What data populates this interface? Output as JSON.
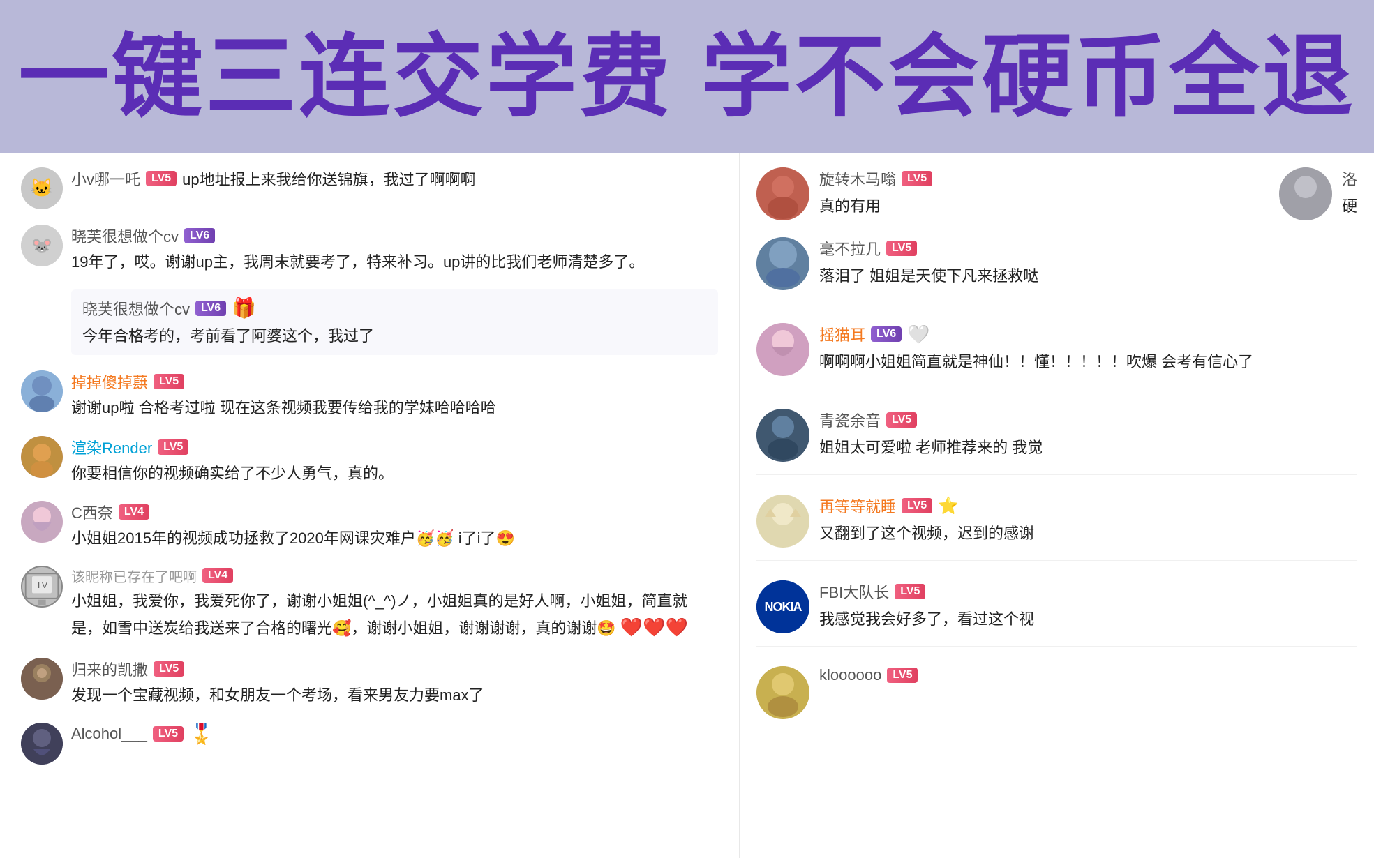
{
  "header": {
    "title": "一键三连交学费 学不会硬币全退"
  },
  "left_comments": [
    {
      "id": "c1",
      "username": "小v哪一吒",
      "username_color": "normal",
      "level": "LV5",
      "level_style": "lv5",
      "avatar_emoji": "🐱",
      "avatar_style": "light-gray",
      "text": "up地址报上来我给你送锦旗，我过了啊啊啊"
    },
    {
      "id": "c2",
      "username": "晓芙很想做个cv",
      "username_color": "normal",
      "level": "LV6",
      "level_style": "lv6",
      "avatar_emoji": "🐭",
      "avatar_style": "light-gray",
      "text": "19年了，哎。谢谢up主，我周末就要考了，特来补习。up讲的比我们老师清楚多了。"
    },
    {
      "id": "c3_nested",
      "username": "晓芙很想做个cv",
      "username_color": "normal",
      "level": "LV6",
      "level_style": "lv6",
      "has_gift": true,
      "text": "今年合格考的，考前看了阿婆这个，我过了"
    },
    {
      "id": "c4",
      "username": "掉掉傻掉蕻",
      "username_color": "orange",
      "level": "LV5",
      "level_style": "lv5",
      "avatar_emoji": "🐶",
      "avatar_style": "blue-anime",
      "text": "谢谢up啦 合格考过啦 现在这条视频我要传给我的学妹哈哈哈哈"
    },
    {
      "id": "c5",
      "username": "渲染Render",
      "username_color": "blue",
      "level": "LV5",
      "level_style": "lv5",
      "avatar_emoji": "🦊",
      "avatar_style": "fox",
      "text": "你要相信你的视频确实给了不少人勇气，真的。"
    },
    {
      "id": "c6",
      "username": "C西奈",
      "username_color": "normal",
      "level": "LV4",
      "level_style": "lv5",
      "avatar_emoji": "🌸",
      "avatar_style": "anime-girl",
      "text": "小姐姐2015年的视频成功拯救了2020年网课灾难户🥳🥳 i了i了😍"
    },
    {
      "id": "c7_deleted",
      "username": "该昵称已存在了吧啊",
      "username_color": "deleted",
      "level": "LV4",
      "level_style": "lv5",
      "avatar_emoji": "📺",
      "avatar_style": "tv",
      "text": "小姐姐，我爱你，我爱死你了，谢谢小姐姐(^_^)ノ，小姐姐真的是好人啊，小姐姐，简直就是，如雪中送炭给我送来了合格的曙光🥰，谢谢小姐姐，谢谢谢谢，真的谢谢🤩 ❤️❤️❤️"
    },
    {
      "id": "c8",
      "username": "归来的凯撒",
      "username_color": "normal",
      "level": "LV5",
      "level_style": "lv5",
      "avatar_emoji": "🦝",
      "avatar_style": "raccoon",
      "text": "发现一个宝藏视频，和女朋友一个考场，看来男友力要max了"
    },
    {
      "id": "c9",
      "username": "Alcohol___",
      "username_color": "normal",
      "level": "LV5",
      "level_style": "lv5",
      "avatar_emoji": "🌙",
      "avatar_style": "anime-dark",
      "has_gift2": true
    }
  ],
  "right_comments": [
    {
      "id": "r1",
      "username": "旋转木马嗡",
      "username_color": "normal",
      "level": "LV5",
      "level_style": "lv5",
      "avatar_emoji": "🙏",
      "avatar_style": "warm",
      "text": "真的有用"
    },
    {
      "id": "r2_extra",
      "username": "洛",
      "username_color": "normal",
      "level": "",
      "text": "硬",
      "avatar_emoji": "🐱",
      "avatar_style": "gray2"
    },
    {
      "id": "r3",
      "username": "毫不拉几",
      "username_color": "normal",
      "level": "LV5",
      "level_style": "lv5",
      "avatar_emoji": "🌅",
      "avatar_style": "sunset",
      "text": "落泪了 姐姐是天使下凡来拯救哒"
    },
    {
      "id": "r4",
      "username": "摇猫耳",
      "username_color": "orange",
      "level": "LV6",
      "level_style": "lv6",
      "avatar_emoji": "🐱",
      "avatar_style": "pink-anime",
      "has_heart": true,
      "text": "啊啊啊小姐姐简直就是神仙！！懂！！！！！吹爆 会考有信心了"
    },
    {
      "id": "r5",
      "username": "青瓷余音",
      "username_color": "normal",
      "level": "LV5",
      "level_style": "lv5",
      "avatar_emoji": "🌊",
      "avatar_style": "blue-dark",
      "text": "姐姐太可爱啦 老师推荐来的 我觉"
    },
    {
      "id": "r6",
      "username": "再等等就睡",
      "username_color": "orange",
      "level": "LV5",
      "level_style": "lv5",
      "avatar_emoji": "🐈",
      "avatar_style": "cat-anime",
      "has_star": true,
      "text": "又翻到了这个视频，迟到的感谢"
    },
    {
      "id": "r7",
      "username": "FBI大队长",
      "username_color": "normal",
      "level": "LV5",
      "level_style": "lv5",
      "avatar_style": "nokia",
      "text": "我感觉我会好多了，看过这个视"
    },
    {
      "id": "r8",
      "username": "kloooooo",
      "username_color": "normal",
      "level": "LV5",
      "level_style": "lv5",
      "avatar_emoji": "🌻",
      "avatar_style": "yellow"
    }
  ]
}
